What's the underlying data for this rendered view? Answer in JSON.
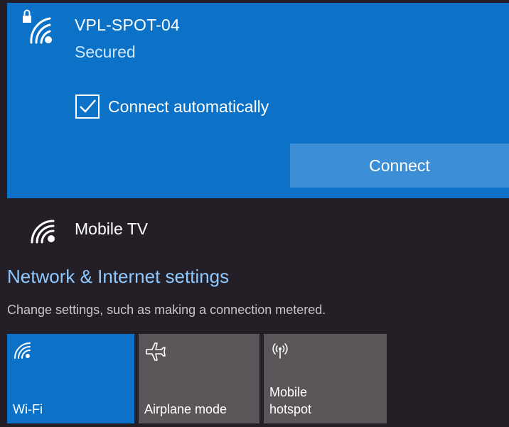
{
  "selected_network": {
    "name": "VPL-SPOT-04",
    "status": "Secured",
    "connect_automatically_label": "Connect automatically",
    "connect_automatically_checked": true,
    "connect_button_label": "Connect",
    "icon": "wifi-secured-icon"
  },
  "other_networks": [
    {
      "name": "Mobile TV",
      "icon": "wifi-icon"
    }
  ],
  "settings": {
    "link_label": "Network & Internet settings",
    "description": "Change settings, such as making a connection metered."
  },
  "quick_actions": [
    {
      "label": "Wi-Fi",
      "icon": "wifi-icon",
      "active": true
    },
    {
      "label": "Airplane mode",
      "icon": "airplane-icon",
      "active": false
    },
    {
      "label_line1": "Mobile",
      "label_line2": "hotspot",
      "icon": "hotspot-icon",
      "active": false
    }
  ],
  "colors": {
    "accent": "#0b72c7",
    "button": "#3c8fd6",
    "background": "#241f27",
    "tile_inactive": "#595559",
    "link": "#8ec9ff"
  }
}
